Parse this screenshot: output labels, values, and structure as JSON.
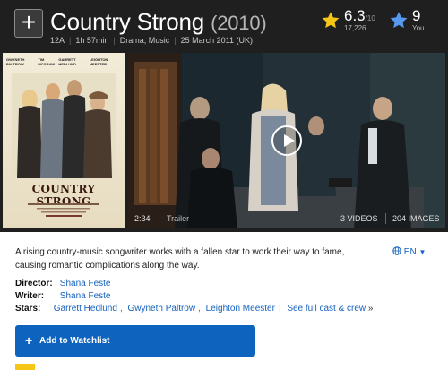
{
  "header": {
    "add_icon_symbol": "+",
    "title": "Country Strong",
    "year": "(2010)",
    "certificate": "12A",
    "runtime": "1h 57min",
    "genres": "Drama, Music",
    "release": "25 March 2011 (UK)"
  },
  "rating": {
    "value": "6.3",
    "out_of": "/10",
    "count": "17,226",
    "star_color": "#f5c518"
  },
  "user_rating": {
    "value": "9",
    "label": "You",
    "star_color": "#5799ef"
  },
  "poster": {
    "cast": [
      "GWYNETH PALTROW",
      "TIM MCGRAW",
      "GARRETT HEDLUND",
      "LEIGHTON MEESTER"
    ],
    "title": "COUNTRY STRONG"
  },
  "video": {
    "duration": "2:34",
    "type": "Trailer",
    "videos_label": "3 VIDEOS",
    "images_label": "204 IMAGES"
  },
  "plot": "A rising country-music songwriter works with a fallen star to work their way to fame, causing romantic complications along the way.",
  "language": {
    "label": "EN"
  },
  "credits": {
    "director_label": "Director:",
    "director": "Shana Feste",
    "writer_label": "Writer:",
    "writer": "Shana Feste",
    "stars_label": "Stars:",
    "stars": [
      "Garrett Hedlund",
      "Gwyneth Paltrow",
      "Leighton Meester"
    ],
    "full_cast": "See full cast & crew",
    "full_cast_arrow": "»"
  },
  "watchlist": {
    "plus": "+",
    "label": "Add to Watchlist"
  }
}
